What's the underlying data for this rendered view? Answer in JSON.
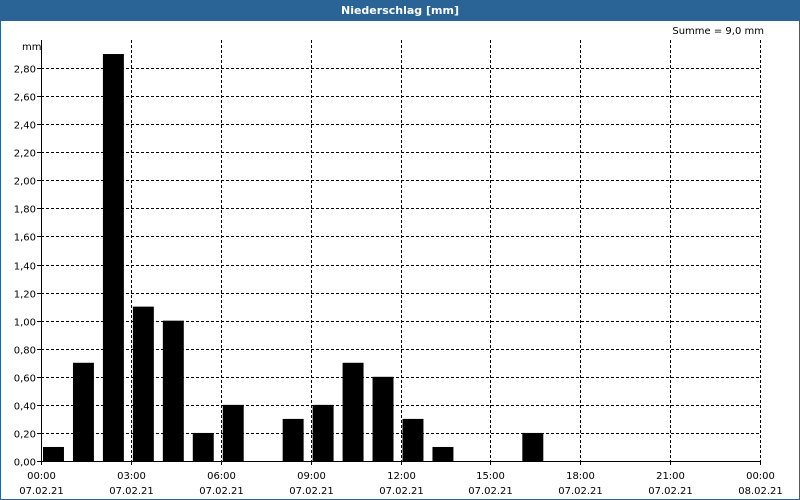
{
  "window": {
    "title": "Niederschlag [mm]"
  },
  "summary": {
    "text": "Summe = 9,0 mm"
  },
  "colors": {
    "titlebar": "#2a6496",
    "bar": "#000000",
    "grid": "#000000"
  },
  "chart_data": {
    "type": "bar",
    "ylabel": "mm",
    "ylim": [
      0,
      3.0
    ],
    "yticks": [
      "0,00",
      "0,20",
      "0,40",
      "0,60",
      "0,80",
      "1,00",
      "1,20",
      "1,40",
      "1,60",
      "1,80",
      "2,00",
      "2,20",
      "2,40",
      "2,60",
      "2,80"
    ],
    "xticks": [
      {
        "time": "00:00",
        "date": "07.02.21"
      },
      {
        "time": "03:00",
        "date": "07.02.21"
      },
      {
        "time": "06:00",
        "date": "07.02.21"
      },
      {
        "time": "09:00",
        "date": "07.02.21"
      },
      {
        "time": "12:00",
        "date": "07.02.21"
      },
      {
        "time": "15:00",
        "date": "07.02.21"
      },
      {
        "time": "18:00",
        "date": "07.02.21"
      },
      {
        "time": "21:00",
        "date": "07.02.21"
      },
      {
        "time": "00:00",
        "date": "08.02.21"
      }
    ],
    "categories": [
      "00:00",
      "01:00",
      "02:00",
      "03:00",
      "04:00",
      "05:00",
      "06:00",
      "07:00",
      "08:00",
      "09:00",
      "10:00",
      "11:00",
      "12:00",
      "13:00",
      "14:00",
      "15:00",
      "16:00",
      "17:00",
      "18:00",
      "19:00",
      "20:00",
      "21:00",
      "22:00",
      "23:00"
    ],
    "values": [
      0.1,
      0.7,
      2.9,
      1.1,
      1.0,
      0.2,
      0.4,
      0,
      0.3,
      0.4,
      0.7,
      0.6,
      0.3,
      0.1,
      0,
      0,
      0.2,
      0,
      0,
      0,
      0,
      0,
      0,
      0
    ]
  }
}
